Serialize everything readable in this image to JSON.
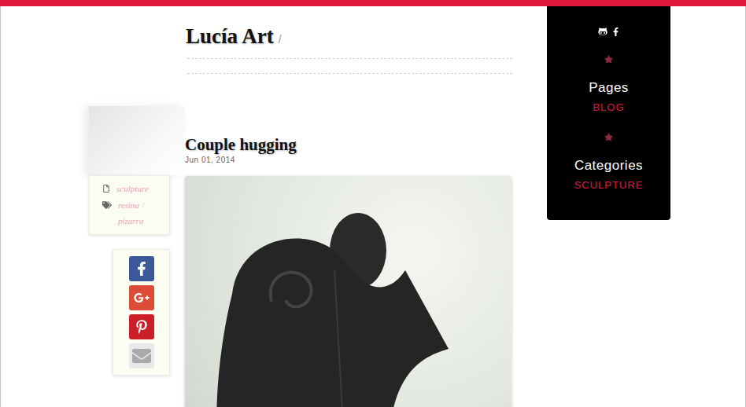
{
  "site": {
    "title": "Lucía Art",
    "separator": "/"
  },
  "sidebar": {
    "sections": [
      {
        "heading": "Pages",
        "links": [
          "BLOG"
        ]
      },
      {
        "heading": "Categories",
        "links": [
          "SCULPTURE"
        ]
      }
    ]
  },
  "post": {
    "title": "Couple hugging",
    "date": "Jun 01, 2014",
    "category": "sculpture",
    "tags": [
      "resina",
      "pizarra"
    ],
    "tag_separator": "/"
  },
  "share": [
    {
      "kind": "facebook",
      "color": "#3b5998"
    },
    {
      "kind": "googleplus",
      "color": "#dd4b39"
    },
    {
      "kind": "pinterest",
      "color": "#cb2027"
    },
    {
      "kind": "email",
      "color": "#e8e8e8"
    }
  ]
}
